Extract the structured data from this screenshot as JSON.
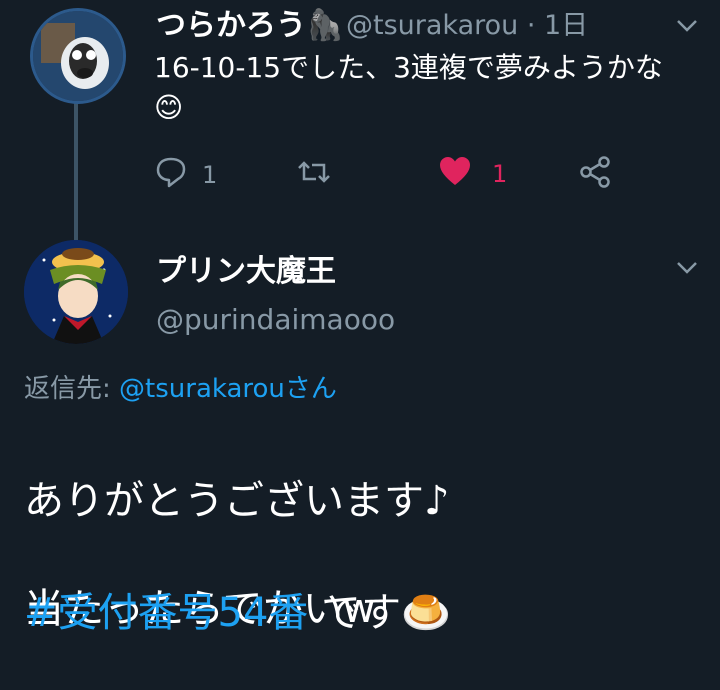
{
  "tweet1": {
    "name": "つらかろう",
    "name_emoji": "🦍",
    "handle_time": "@tsurakarou · 1日",
    "text": "16-10-15でした、3連複で夢みようかな",
    "text_emoji": "😊",
    "reply_count": "1",
    "like_count": "1"
  },
  "tweet2": {
    "name": "プリン大魔王",
    "handle": "@purindaimaooo",
    "reply_prefix": "返信先: ",
    "reply_mention": "@tsurakarou",
    "reply_suffix": "さん",
    "line1": "ありがとうございます♪",
    "line2": "当たったらでかいw",
    "hashtag": "#受付番号54番",
    "after_hashtag": " です",
    "end_emoji": "🍮"
  },
  "colors": {
    "background": "#141d26",
    "muted": "#8899a6",
    "accent": "#1da1f2",
    "like": "#e0245e",
    "thread": "#3d5466"
  },
  "icons": [
    "reply-icon",
    "retweet-icon",
    "heart-icon",
    "share-icon",
    "chevron-down-icon"
  ]
}
